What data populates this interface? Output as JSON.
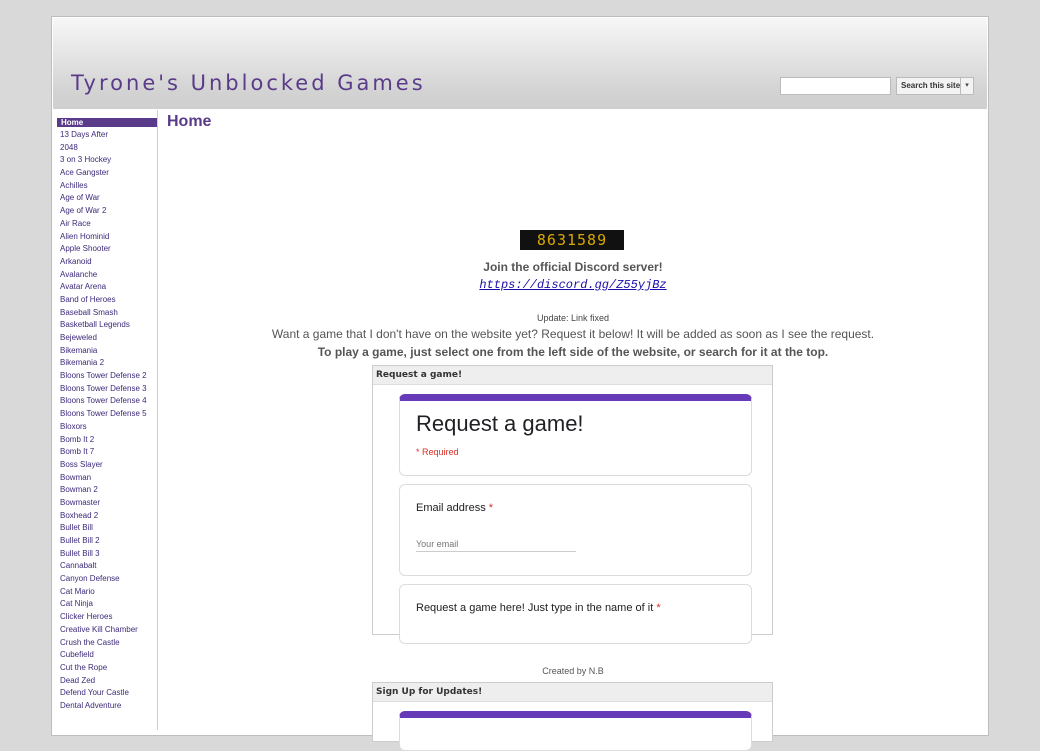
{
  "site": {
    "title": "Tyrone's Unblocked Games"
  },
  "search": {
    "placeholder": "",
    "button_label": "Search this site",
    "dropdown_glyph": "▾"
  },
  "sidebar": {
    "items": [
      "Home",
      "13 Days After",
      "2048",
      "3 on 3 Hockey",
      "Ace Gangster",
      "Achilles",
      "Age of War",
      "Age of War 2",
      "Air Race",
      "Alien Hominid",
      "Apple Shooter",
      "Arkanoid",
      "Avalanche",
      "Avatar Arena",
      "Band of Heroes",
      "Baseball Smash",
      "Basketball Legends",
      "Bejeweled",
      "Bikemania",
      "Bikemania 2",
      "Bloons Tower Defense 2",
      "Bloons Tower Defense 3",
      "Bloons Tower Defense 4",
      "Bloons Tower Defense 5",
      "Bloxors",
      "Bomb It 2",
      "Bomb It 7",
      "Boss Slayer",
      "Bowman",
      "Bowman 2",
      "Bowmaster",
      "Boxhead 2",
      "Bullet Bill",
      "Bullet Bill 2",
      "Bullet Bill 3",
      "Cannabalt",
      "Canyon Defense",
      "Cat Mario",
      "Cat Ninja",
      "Clicker Heroes",
      "Creative Kill Chamber",
      "Crush the Castle",
      "Cubefield",
      "Cut the Rope",
      "Dead Zed",
      "Defend Your Castle",
      "Dental Adventure"
    ],
    "active_index": 0
  },
  "main": {
    "page_title": "Home",
    "counter": "8631589",
    "discord_text": "Join the official Discord server!",
    "discord_link": "https://discord.gg/Z55yjBz",
    "update_note": "Update: Link fixed",
    "request_note": "Want a game that I don't have on the website yet? Request it below! It will be added as soon as I see the request.",
    "play_note": "To play a game, just select one from the left side of the website, or search for it at the top.",
    "request_gadget": {
      "title": "Request a game!",
      "form_title": "Request a game!",
      "required_note": "* Required",
      "email_label": "Email address",
      "email_placeholder": "Your email",
      "game_label": "Request a game here! Just type in the name of it",
      "required_star": "*"
    },
    "created_by": "Created by N.B",
    "signup_gadget": {
      "title": "Sign Up for Updates!"
    }
  },
  "colors": {
    "accent": "#5a3b8a",
    "form_accent": "#673ab7",
    "required": "#d93025"
  }
}
